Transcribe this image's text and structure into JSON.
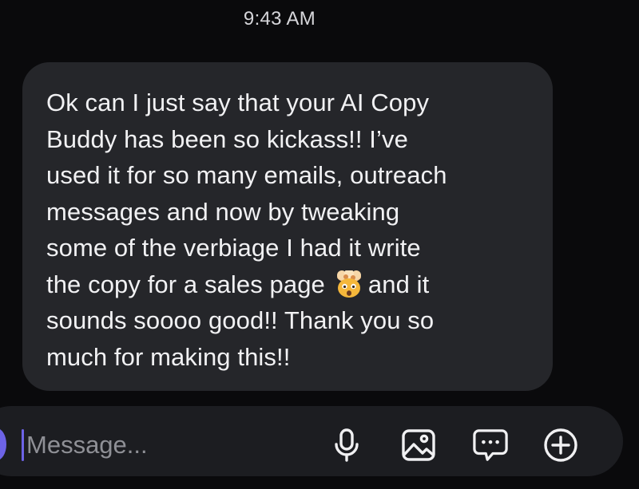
{
  "header": {
    "timestamp": "9:43 AM"
  },
  "message": {
    "lines": [
      "Ok can I just say that your AI Copy",
      "Buddy has been so kickass!! I’ve",
      "used it for so many emails, outreach",
      "messages and now by tweaking",
      "some of the verbiage I had it write",
      "the copy for a sales page",
      "and it",
      "sounds soooo good!! Thank you so",
      "much for making this!!"
    ],
    "emoji": "exploding-head-emoji"
  },
  "composer": {
    "placeholder": "Message...",
    "icons": [
      "microphone-icon",
      "image-icon",
      "chat-bubble-icon",
      "plus-circle-icon"
    ]
  },
  "colors": {
    "background": "#0a0a0c",
    "bubble": "#25262a",
    "composer": "#1c1d21",
    "accent": "#6d63e6",
    "text": "#f1f1f3"
  }
}
